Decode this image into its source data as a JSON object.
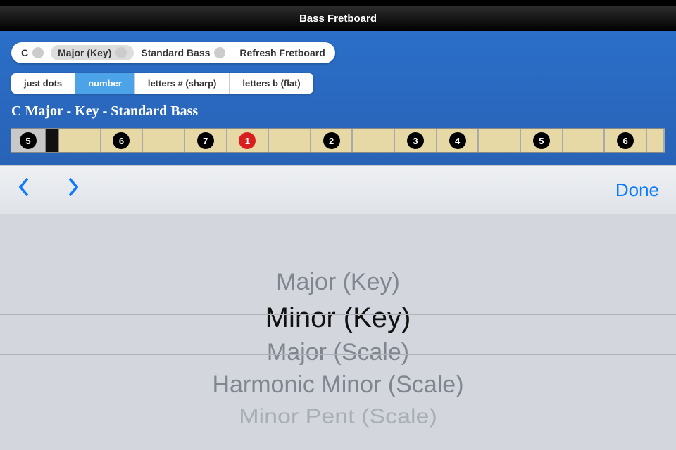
{
  "title": "Bass Fretboard",
  "toolbar": {
    "root": "C",
    "scale": "Major (Key)",
    "tuning": "Standard Bass",
    "refresh": "Refresh Fretboard"
  },
  "display_modes": {
    "dots": "just dots",
    "number": "number",
    "sharp": "letters # (sharp)",
    "flat": "letters b (flat)"
  },
  "heading": "C Major - Key - Standard Bass",
  "fret_notes": [
    "5",
    "6",
    "7",
    "1",
    "2",
    "3",
    "4",
    "5",
    "6"
  ],
  "picker_toolbar": {
    "done": "Done"
  },
  "picker_options": {
    "prev1": "Major (Key)",
    "selected": "Minor (Key)",
    "next1": "Major (Scale)",
    "next2": "Harmonic Minor (Scale)",
    "next3": "Minor Pent (Scale)"
  }
}
